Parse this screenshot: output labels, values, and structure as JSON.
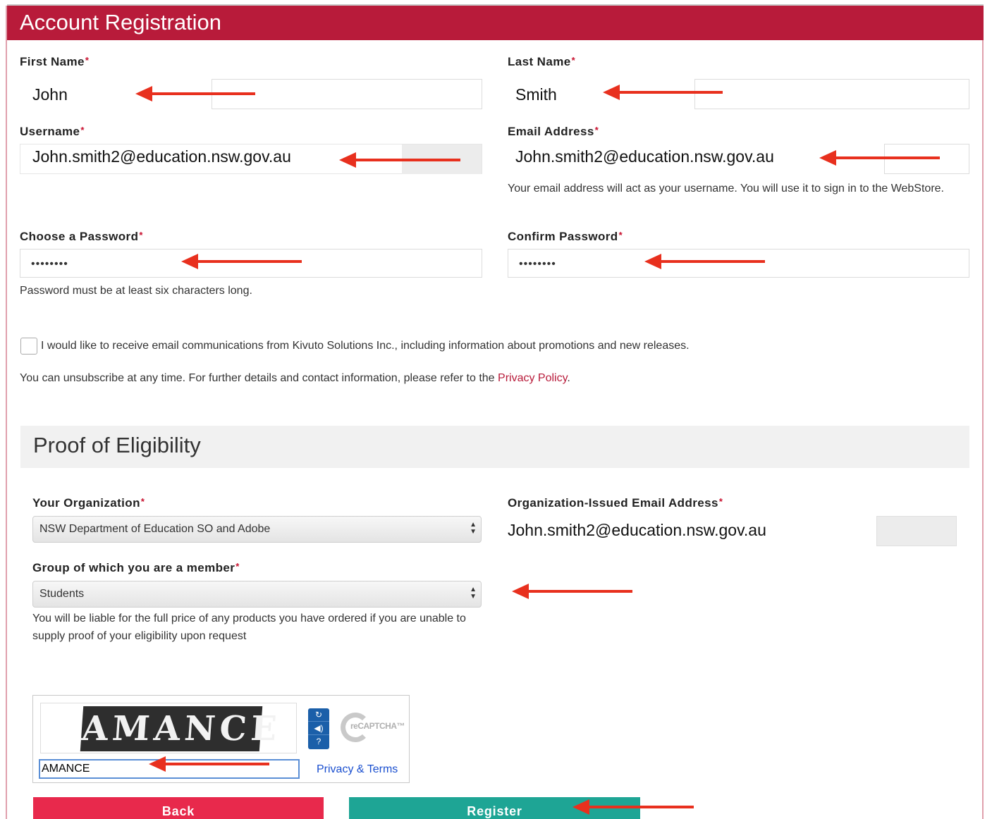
{
  "header": {
    "title": "Account Registration"
  },
  "form": {
    "first_name": {
      "label": "First Name",
      "value": "John"
    },
    "last_name": {
      "label": "Last Name",
      "value": "Smith"
    },
    "username": {
      "label": "Username",
      "value": "John.smith2@education.nsw.gov.au"
    },
    "email": {
      "label": "Email Address",
      "value": "John.smith2@education.nsw.gov.au",
      "help": "Your email address will act as your username. You will use it to sign in to the WebStore."
    },
    "password": {
      "label": "Choose a Password",
      "value": "••••••••",
      "help": "Password must be at least six characters long."
    },
    "confirm_password": {
      "label": "Confirm Password",
      "value": "••••••••"
    },
    "required_marker": "*",
    "newsletter": {
      "checked": false,
      "label": "I would like to receive email communications from Kivuto Solutions Inc., including information about promotions and new releases.",
      "note_prefix": "You can unsubscribe at any time. For further details and contact information, please refer to the ",
      "note_link": "Privacy Policy",
      "note_suffix": "."
    }
  },
  "eligibility": {
    "title": "Proof of Eligibility",
    "organization": {
      "label": "Your Organization",
      "selected": "NSW Department of Education SO and Adobe"
    },
    "org_email": {
      "label": "Organization-Issued Email Address",
      "value": "John.smith2@education.nsw.gov.au"
    },
    "group": {
      "label": "Group of which you are a member",
      "selected": "Students",
      "help": "You will be liable for the full price of any products you have ordered if you are unable to supply proof of your eligibility upon request"
    }
  },
  "captcha": {
    "challenge_text": "AMANCE",
    "input_value": "AMANCE",
    "logo_text": "reCAPTCHA™",
    "privacy_link": "Privacy & Terms",
    "icons": [
      "refresh-icon",
      "audio-icon",
      "help-icon"
    ]
  },
  "buttons": {
    "back": "Back",
    "register": "Register"
  },
  "colors": {
    "brand": "#b81b3a",
    "back_button": "#e8294c",
    "register_button": "#1ea595",
    "annotation_arrow": "#e8301e"
  }
}
